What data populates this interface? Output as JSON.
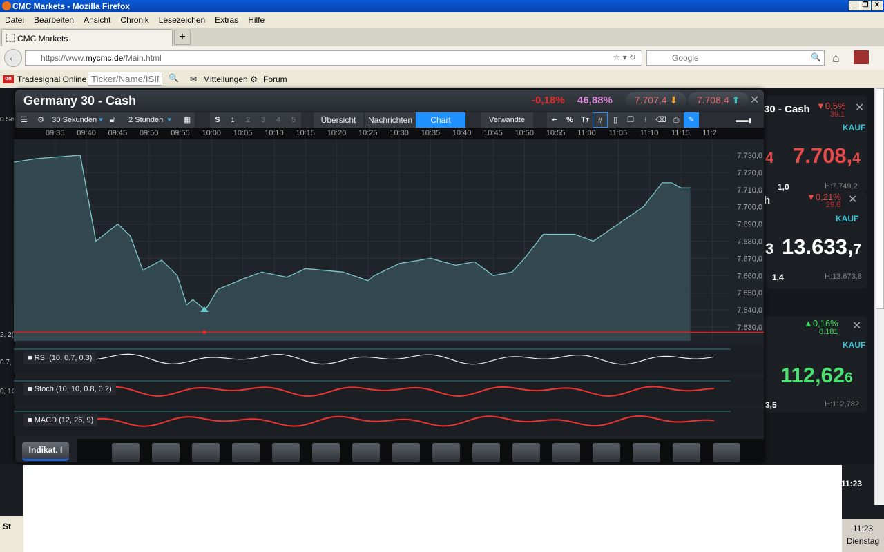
{
  "browser": {
    "title": "CMC Markets - Mozilla Firefox",
    "menu": [
      "Datei",
      "Bearbeiten",
      "Ansicht",
      "Chronik",
      "Lesezeichen",
      "Extras",
      "Hilfe"
    ],
    "tab": "CMC Markets",
    "url_pre": "https://www.",
    "url_host": "mycmc.de",
    "url_path": "/Main.html",
    "search_placeholder": "Google",
    "bookmarks": {
      "tradesignal": "Tradesignal Online",
      "ticker_placeholder": "Ticker/Name/ISIN",
      "mitteilungen": "Mitteilungen",
      "forum": "Forum"
    }
  },
  "chart_window": {
    "title": "Germany 30 - Cash",
    "change": "-0,18%",
    "sentiment": "46,88%",
    "sell": "7.707,4",
    "buy": "7.708,4",
    "toolbar": {
      "interval": "30 Sekunden",
      "range": "2 Stunden",
      "s": "S",
      "slots": [
        "1",
        "2",
        "3",
        "4",
        "5"
      ],
      "tabs": [
        "Übersicht",
        "Nachrichten",
        "Chart",
        "Verwandte"
      ],
      "tools": [
        "%",
        "Tт"
      ]
    },
    "indicators": [
      "RSI (10, 0.7, 0.3)",
      "Stoch (10, 10, 0.8, 0.2)",
      "MACD (12, 26, 9)"
    ],
    "indikat_button": "Indikat. I",
    "left_cut": [
      "0 Se",
      "2, 2(",
      "0.7, :",
      "0, 1C"
    ]
  },
  "chart_data": {
    "type": "area",
    "ylim": [
      7625,
      7735
    ],
    "yticks": [
      "7.730,0",
      "7.720,0",
      "7.710,0",
      "7.700,0",
      "7.690,0",
      "7.680,0",
      "7.670,0",
      "7.660,0",
      "7.650,0",
      "7.640,0",
      "7.630,0"
    ],
    "xticks": [
      "09:35",
      "09:40",
      "09:45",
      "09:50",
      "09:55",
      "10:00",
      "10:05",
      "10:10",
      "10:15",
      "10:20",
      "10:25",
      "10:30",
      "10:35",
      "10:40",
      "10:45",
      "10:50",
      "10:55",
      "11:00",
      "11:05",
      "11:10",
      "11:15",
      "11:2"
    ],
    "x": [
      -6.6,
      -3,
      4,
      6.5,
      10,
      12,
      14,
      17,
      19.5,
      21,
      22,
      24,
      26,
      30,
      33,
      37,
      40,
      46,
      50,
      51,
      55,
      60,
      64,
      67,
      70,
      73,
      75,
      78,
      80,
      83,
      86,
      90,
      94,
      97,
      98.5,
      100,
      101.5
    ],
    "y": [
      7726,
      7728,
      7730,
      7680,
      7690,
      7683,
      7663,
      7669,
      7660,
      7643,
      7646,
      7640,
      7652,
      7658,
      7662,
      7659,
      7664,
      7662,
      7657,
      7660,
      7667,
      7670,
      7666,
      7668,
      7660,
      7662,
      7670,
      7684,
      7684,
      7684,
      7680,
      7690,
      7700,
      7714,
      7714,
      7711,
      7711
    ],
    "x_unit": "minutes after 09:35",
    "red_line": 7627
  },
  "watchlist": [
    {
      "name": "30 - Cash",
      "change": "▼0,5%",
      "points": "39.1",
      "label": "KAUF",
      "price_main": "7.708,",
      "price_small": "4",
      "left": "4",
      "spread": "1,0",
      "high": "H:7.749,2"
    },
    {
      "name": "h",
      "change": "▼0,21%",
      "points": "29.8",
      "label": "KAUF",
      "price_main": "13.633,",
      "price_small": "7",
      "left": "3",
      "spread": "1,4",
      "high": "H:13.673,8"
    },
    {
      "name": "",
      "change": "▲0,16%",
      "points": "0.181",
      "label": "KAUF",
      "price_main": "112,62",
      "price_small": "6",
      "left": "",
      "spread": "3,5",
      "high": "H:112,782"
    }
  ],
  "clock": "11:23",
  "tray": {
    "time": "11:23",
    "day": "Dienstag"
  },
  "start": "St",
  "colors": {
    "accent": "#1e90ff",
    "red": "#e84a4a",
    "green": "#3de05a",
    "teal": "#3cc4c4"
  }
}
